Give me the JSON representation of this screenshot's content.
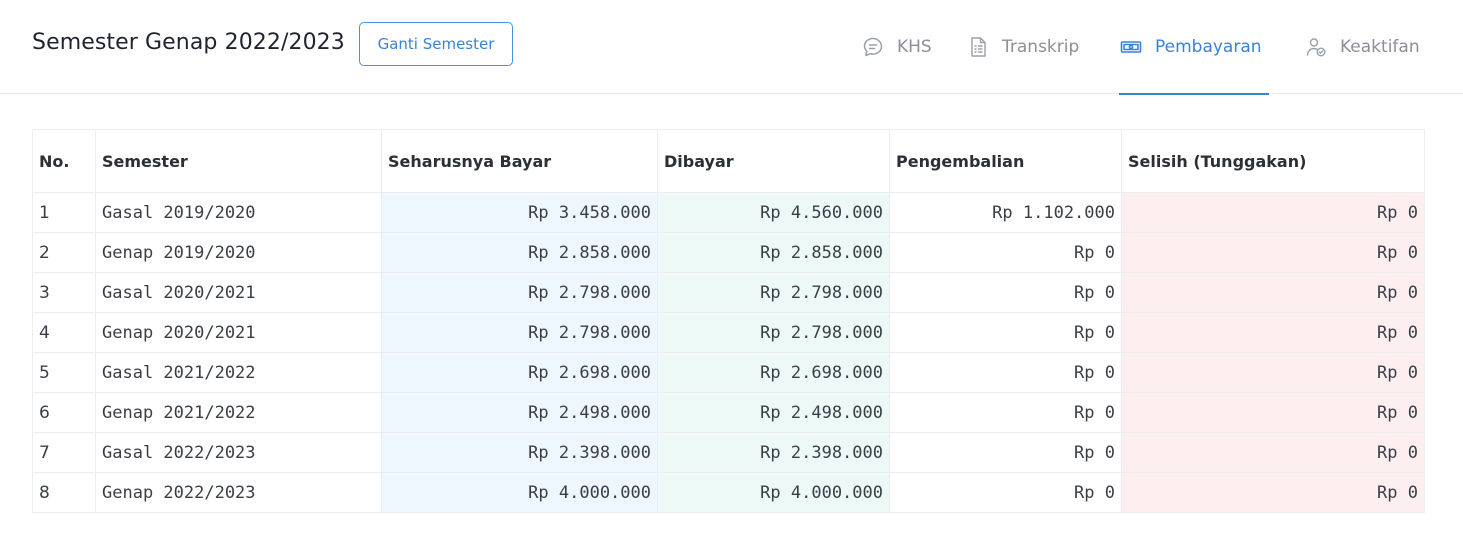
{
  "header": {
    "title": "Semester Genap 2022/2023",
    "switch_button": "Ganti Semester"
  },
  "tabs": [
    {
      "label": "KHS",
      "icon": "chat-bubble-icon",
      "active": false
    },
    {
      "label": "Transkrip",
      "icon": "document-icon",
      "active": false
    },
    {
      "label": "Pembayaran",
      "icon": "money-icon",
      "active": true
    },
    {
      "label": "Keaktifan",
      "icon": "user-check-icon",
      "active": false
    }
  ],
  "colors": {
    "accent": "#3b82d6",
    "bill_bg": "#eef6fe",
    "paid_bg": "#ecf9f6",
    "diff_bg": "#fdeef0"
  },
  "table": {
    "headers": [
      "No.",
      "Semester",
      "Seharusnya Bayar",
      "Dibayar",
      "Pengembalian",
      "Selisih (Tunggakan)"
    ],
    "rows": [
      {
        "no": "1",
        "semester": "Gasal 2019/2020",
        "bill": "Rp 3.458.000",
        "paid": "Rp 4.560.000",
        "refund": "Rp 1.102.000",
        "diff": "Rp 0"
      },
      {
        "no": "2",
        "semester": "Genap 2019/2020",
        "bill": "Rp 2.858.000",
        "paid": "Rp 2.858.000",
        "refund": "Rp 0",
        "diff": "Rp 0"
      },
      {
        "no": "3",
        "semester": "Gasal 2020/2021",
        "bill": "Rp 2.798.000",
        "paid": "Rp 2.798.000",
        "refund": "Rp 0",
        "diff": "Rp 0"
      },
      {
        "no": "4",
        "semester": "Genap 2020/2021",
        "bill": "Rp 2.798.000",
        "paid": "Rp 2.798.000",
        "refund": "Rp 0",
        "diff": "Rp 0"
      },
      {
        "no": "5",
        "semester": "Gasal 2021/2022",
        "bill": "Rp 2.698.000",
        "paid": "Rp 2.698.000",
        "refund": "Rp 0",
        "diff": "Rp 0"
      },
      {
        "no": "6",
        "semester": "Genap 2021/2022",
        "bill": "Rp 2.498.000",
        "paid": "Rp 2.498.000",
        "refund": "Rp 0",
        "diff": "Rp 0"
      },
      {
        "no": "7",
        "semester": "Gasal 2022/2023",
        "bill": "Rp 2.398.000",
        "paid": "Rp 2.398.000",
        "refund": "Rp 0",
        "diff": "Rp 0"
      },
      {
        "no": "8",
        "semester": "Genap 2022/2023",
        "bill": "Rp 4.000.000",
        "paid": "Rp 4.000.000",
        "refund": "Rp 0",
        "diff": "Rp 0"
      }
    ]
  }
}
